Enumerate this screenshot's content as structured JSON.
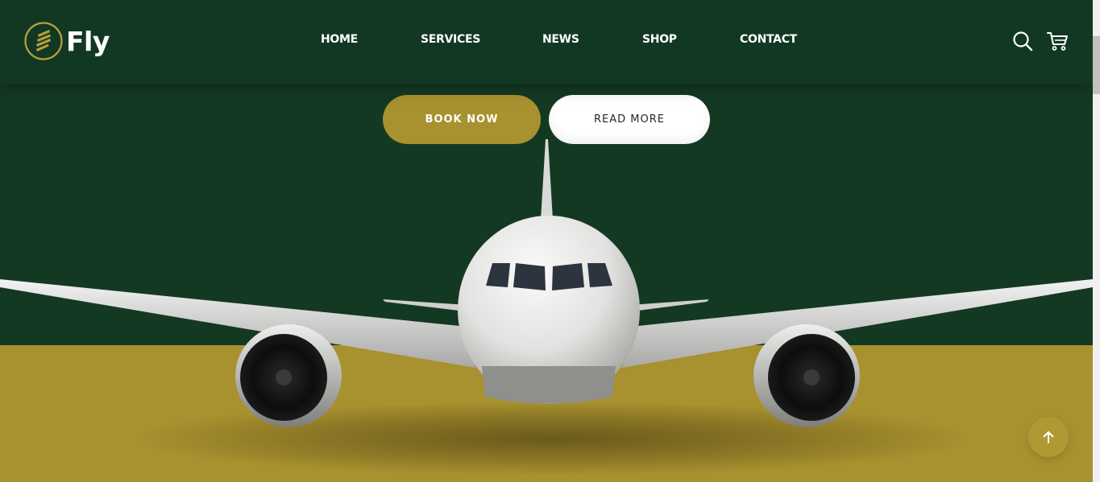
{
  "brand": {
    "name": "Fly",
    "logo_icon": "striped-circle-logo-icon"
  },
  "nav": {
    "items": [
      {
        "label": "HOME"
      },
      {
        "label": "SERVICES"
      },
      {
        "label": "NEWS"
      },
      {
        "label": "SHOP"
      },
      {
        "label": "CONTACT"
      }
    ]
  },
  "header_icons": {
    "search": "search-icon",
    "cart": "cart-icon"
  },
  "hero": {
    "primary_button": "BOOK NOW",
    "secondary_button": "READ MORE",
    "image": "airplane-front-view"
  },
  "back_to_top_icon": "arrow-up-icon",
  "colors": {
    "primary_green": "#143923",
    "header_green": "#123823",
    "accent_gold": "#a8912f",
    "white": "#ffffff"
  }
}
